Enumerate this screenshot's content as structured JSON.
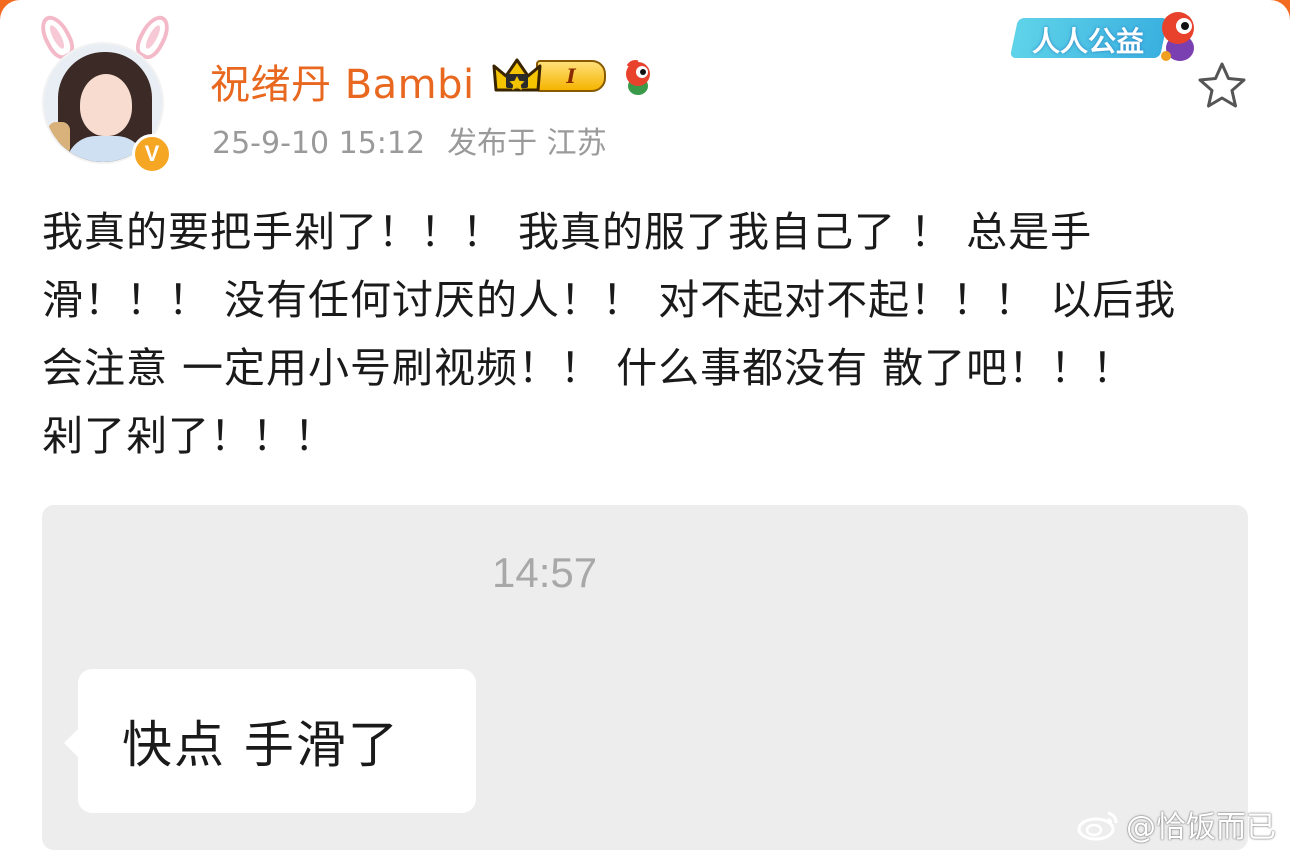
{
  "header": {
    "user_name": "祝绪丹 Bambi",
    "vip_level": "I",
    "verified_mark": "V",
    "timestamp": "25-9-10 15:12",
    "location": "发布于 江苏",
    "promo_label": "人人公益"
  },
  "post": {
    "lines": [
      "我真的要把手剁了！！！ 我真的服了我自己了 ！ 总是手",
      "滑！！！ 没有任何讨厌的人！！ 对不起对不起！！！ 以后我",
      "会注意 一定用小号刷视频！！ 什么事都没有 散了吧！！！",
      "剁了剁了！！！"
    ]
  },
  "image": {
    "chat_time": "14:57",
    "message": "快点 手滑了"
  },
  "watermark": {
    "text": "@恰饭而已"
  },
  "colors": {
    "name_orange": "#e9681f",
    "meta_gray": "#9a9a9a",
    "card_bg": "#ededed"
  },
  "icons": [
    "bunny-ears",
    "verified-v",
    "crown",
    "mascot",
    "star",
    "weibo-logo"
  ]
}
